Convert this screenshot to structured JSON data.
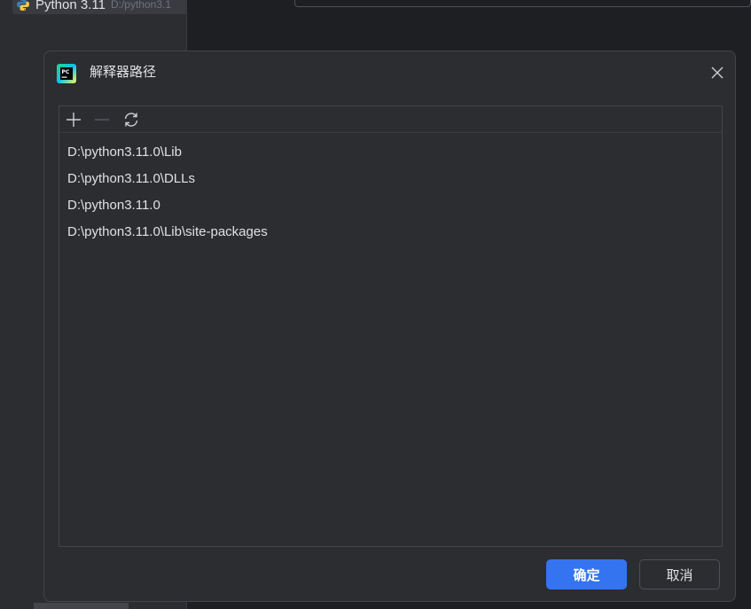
{
  "background": {
    "interpreter_name": "Python 3.11",
    "interpreter_path": "D:/python3.1"
  },
  "dialog": {
    "title": "解释器路径",
    "toolbar": {
      "add_icon": "plus-icon",
      "remove_icon": "minus-icon",
      "refresh_icon": "refresh-icon"
    },
    "paths": [
      "D:\\python3.11.0\\Lib",
      "D:\\python3.11.0\\DLLs",
      "D:\\python3.11.0",
      "D:\\python3.11.0\\Lib\\site-packages"
    ],
    "ok_label": "确定",
    "cancel_label": "取消"
  },
  "colors": {
    "accent": "#3574f0",
    "dialog_bg": "#2b2d30",
    "border": "#43454a",
    "text": "#dfe1e5"
  }
}
